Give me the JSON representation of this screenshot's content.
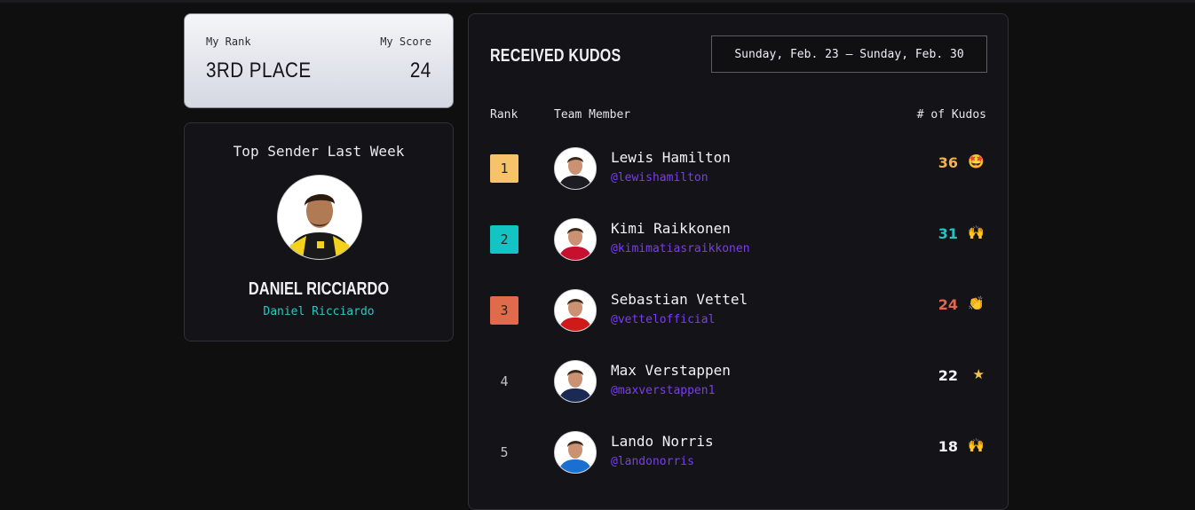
{
  "my_stats": {
    "rank_label": "My Rank",
    "score_label": "My Score",
    "rank_value": "3RD PLACE",
    "score_value": "24"
  },
  "top_sender": {
    "title": "Top Sender Last Week",
    "name": "DANIEL RICCIARDO",
    "handle": "Daniel Ricciardo",
    "avatar_icon": "driver-avatar-yellow"
  },
  "kudos": {
    "heading": "RECEIVED KUDOS",
    "date_range": "Sunday, Feb. 23 – Sunday, Feb. 30",
    "columns": {
      "rank": "Rank",
      "member": "Team Member",
      "kudos": "# of Kudos"
    },
    "rows": [
      {
        "rank": "1",
        "name": "Lewis Hamilton",
        "handle": "@lewishamilton",
        "count": "36",
        "emoji": "🤩",
        "badge_color": "#f6c26a",
        "count_color": "#f1b24e",
        "suit_color": "#1c1c22"
      },
      {
        "rank": "2",
        "name": "Kimi Raikkonen",
        "handle": "@kimimatiasraikkonen",
        "count": "31",
        "emoji": "🙌",
        "badge_color": "#14c4c4",
        "count_color": "#1fc6c4",
        "suit_color": "#c8102e"
      },
      {
        "rank": "3",
        "name": "Sebastian Vettel",
        "handle": "@vettelofficial",
        "count": "24",
        "emoji": "👏",
        "badge_color": "#e06a4c",
        "count_color": "#e0664c",
        "suit_color": "#d01a1a"
      },
      {
        "rank": "4",
        "name": "Max Verstappen",
        "handle": "@maxverstappen1",
        "count": "22",
        "emoji": "★",
        "badge_color": "",
        "count_color": "#f2f2f5",
        "suit_color": "#1b2a55"
      },
      {
        "rank": "5",
        "name": "Lando Norris",
        "handle": "@landonorris",
        "count": "18",
        "emoji": "🙌",
        "badge_color": "",
        "count_color": "#f2f2f5",
        "suit_color": "#1a6fd1"
      }
    ]
  }
}
